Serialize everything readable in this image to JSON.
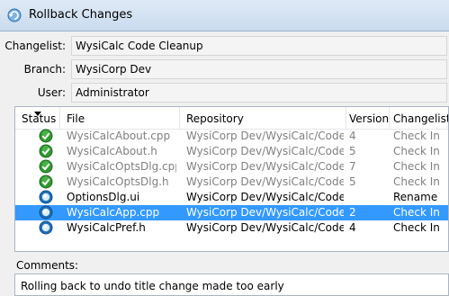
{
  "window": {
    "title": "Rollback Changes",
    "icon": "rollback-icon"
  },
  "fields": {
    "changelist": {
      "label": "Changelist:",
      "value": "WysiCalc Code Cleanup"
    },
    "branch": {
      "label": "Branch:",
      "value": "WysiCorp Dev"
    },
    "user": {
      "label": "User:",
      "value": "Administrator"
    }
  },
  "table": {
    "columns": [
      "Status",
      "File",
      "Repository",
      "Version",
      "Changelist A"
    ],
    "sorted_column": "Status",
    "rows": [
      {
        "status": "checked",
        "file": "WysiCalcAbout.cpp",
        "repository": "WysiCorp Dev/WysiCalc/Code/...",
        "version": "4",
        "action": "Check In",
        "style": "gray"
      },
      {
        "status": "checked",
        "file": "WysiCalcAbout.h",
        "repository": "WysiCorp Dev/WysiCalc/Code/...",
        "version": "5",
        "action": "Check In",
        "style": "gray"
      },
      {
        "status": "checked",
        "file": "WysiCalcOptsDlg.cpp",
        "repository": "WysiCorp Dev/WysiCalc/Code/...",
        "version": "7",
        "action": "Check In",
        "style": "gray"
      },
      {
        "status": "checked",
        "file": "WysiCalcOptsDlg.h",
        "repository": "WysiCorp Dev/WysiCalc/Code/...",
        "version": "5",
        "action": "Check In",
        "style": "gray"
      },
      {
        "status": "pending",
        "file": "OptionsDlg.ui",
        "repository": "WysiCorp Dev/WysiCalc/Code/...",
        "version": "",
        "action": "Rename",
        "style": "normal"
      },
      {
        "status": "pending",
        "file": "WysiCalcApp.cpp",
        "repository": "WysiCorp Dev/WysiCalc/Code/...",
        "version": "2",
        "action": "Check In",
        "style": "selected"
      },
      {
        "status": "pending",
        "file": "WysiCalcPref.h",
        "repository": "WysiCorp Dev/WysiCalc/Code/...",
        "version": "4",
        "action": "Check In",
        "style": "normal"
      }
    ]
  },
  "comments": {
    "label": "Comments:",
    "value": "Rolling back to undo title change made too early"
  },
  "colors": {
    "selection": "#3399ff",
    "check_green": "#2f9a2f",
    "pending_blue": "#1d6fb8"
  }
}
